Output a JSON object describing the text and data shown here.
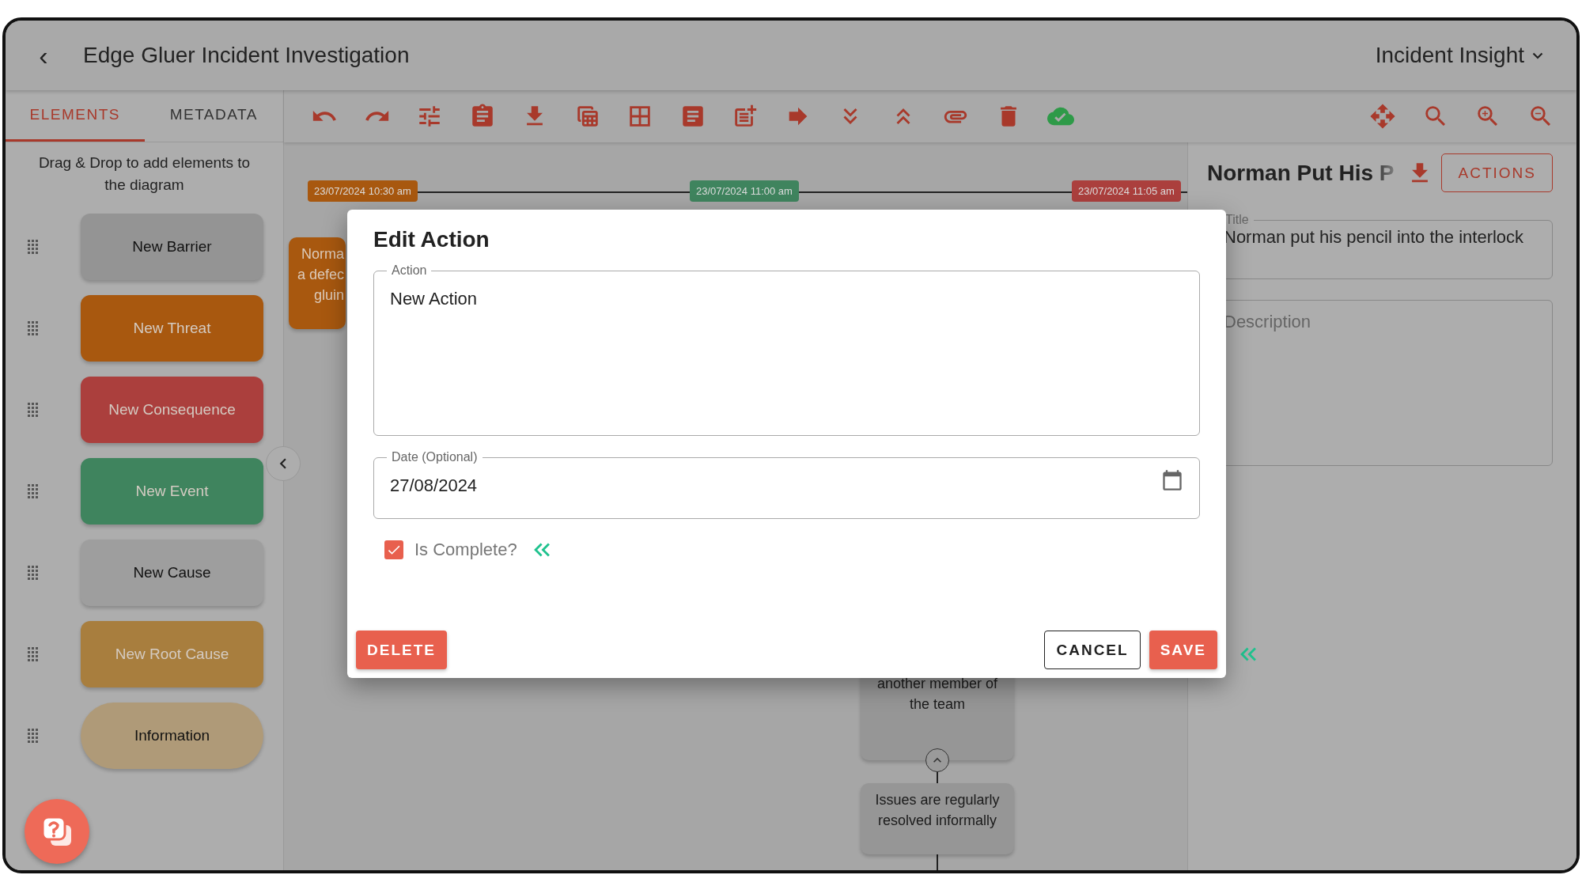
{
  "header": {
    "back": "‹",
    "title": "Edge Gluer Incident Investigation",
    "product": "Incident Insight"
  },
  "sidebar": {
    "tabs": [
      {
        "label": "ELEMENTS",
        "selected": true
      },
      {
        "label": "METADATA",
        "selected": false
      }
    ],
    "hint": "Drag & Drop to add elements to the diagram",
    "elements": [
      {
        "label": "New Barrier",
        "color": "#949494",
        "kind": "rounded"
      },
      {
        "label": "New Threat",
        "color": "#a8580f",
        "kind": "rounded"
      },
      {
        "label": "New Consequence",
        "color": "#ab3f3d",
        "kind": "rounded"
      },
      {
        "label": "New Event",
        "color": "#3f845e",
        "kind": "rounded"
      },
      {
        "label": "New Cause",
        "color": "#9e9e9e",
        "kind": "rounded"
      },
      {
        "label": "New Root Cause",
        "color": "#a87e3e",
        "kind": "rounded"
      },
      {
        "label": "Information",
        "color": "#af9a78",
        "kind": "pill"
      }
    ]
  },
  "canvas": {
    "timeline": [
      {
        "label": "23/07/2024 10:30 am",
        "color": "#a8580f"
      },
      {
        "label": "23/07/2024 11:00 am",
        "color": "#3f845e"
      },
      {
        "label": "23/07/2024 11:05 am",
        "color": "#ab3f3d"
      }
    ],
    "nodes": [
      {
        "text": "Norma\na defec\ngluin",
        "color": "#a8580f"
      },
      {
        "text": "another member of\nthe team",
        "color": "#969696"
      },
      {
        "text": "Issues are regularly\nresolved informally",
        "color": "#969696"
      }
    ]
  },
  "panel": {
    "heading": "Norman Put His P",
    "actions": "ACTIONS",
    "title_label": "Title",
    "title_value": "Norman put his pencil into the interlock",
    "description": {
      "placeholder": "Description"
    }
  },
  "dialog": {
    "title": "Edit Action",
    "action_label": "Action",
    "action_value": "New Action",
    "date_label": "Date (Optional)",
    "date_value": "27/08/2024",
    "complete_label": "Is Complete?",
    "complete": {
      "checked": true
    },
    "delete": "DELETE",
    "cancel": "CANCEL",
    "save": "SAVE"
  }
}
